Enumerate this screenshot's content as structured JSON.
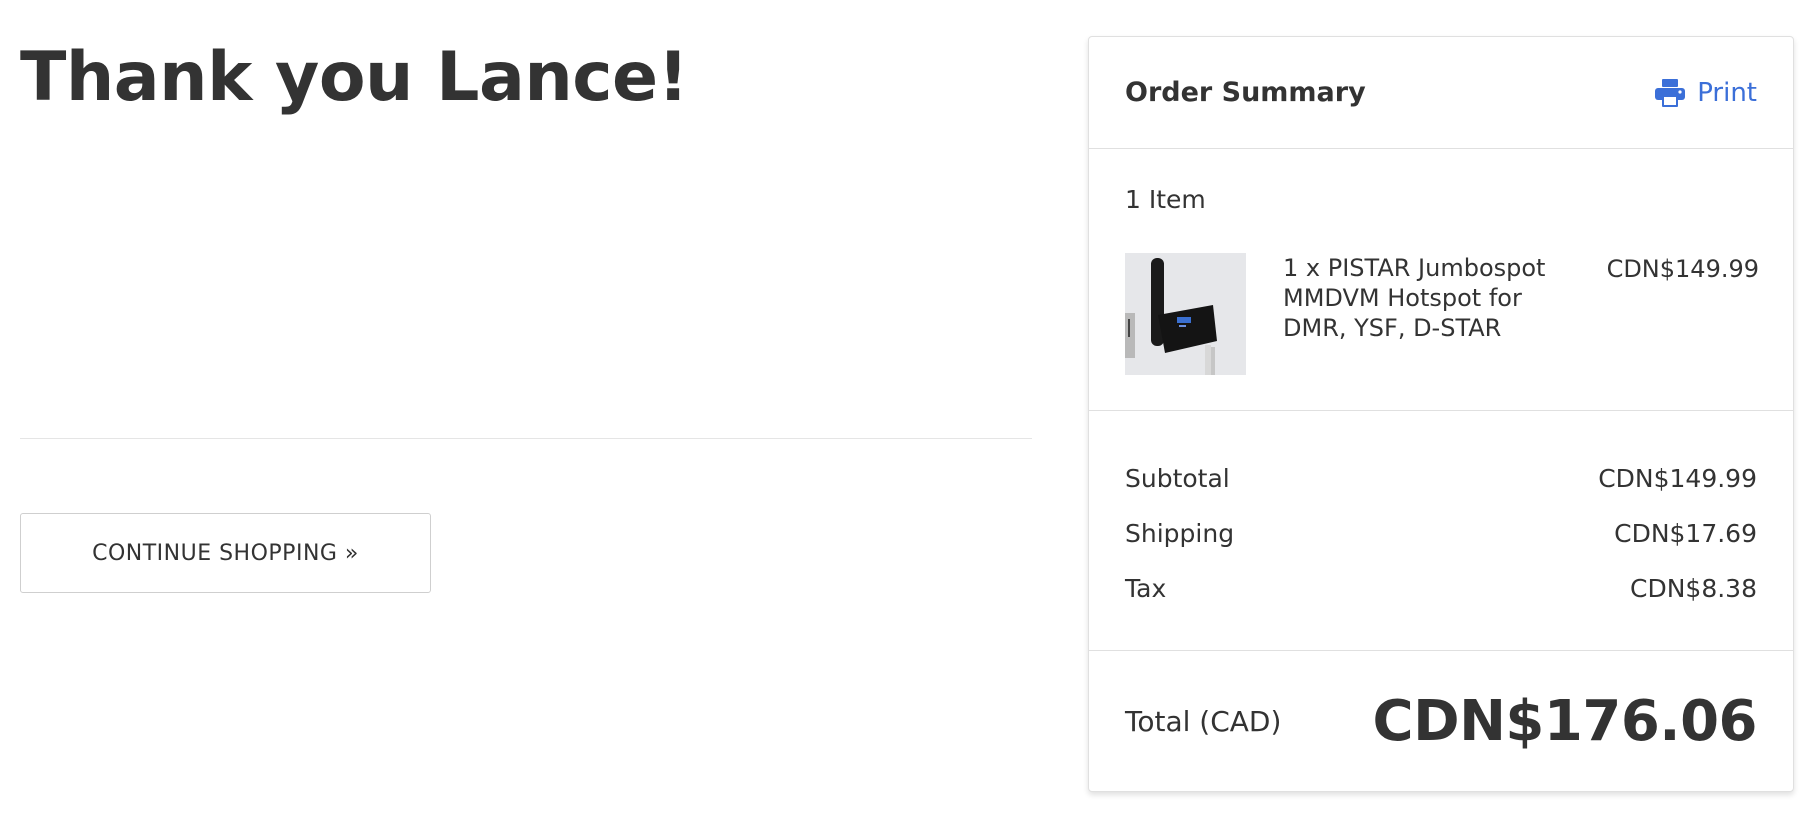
{
  "heading": "Thank you Lance!",
  "continue_button": "CONTINUE SHOPPING »",
  "summary": {
    "title": "Order Summary",
    "print_label": "Print",
    "print_icon": "printer-icon",
    "accent_color": "#3b6fd8",
    "item_count": "1 Item",
    "items": [
      {
        "name": "1 x PISTAR Jumbospot MMDVM Hotspot for DMR, YSF, D-STAR",
        "price": "CDN$149.99"
      }
    ],
    "subtotal_label": "Subtotal",
    "subtotal_value": "CDN$149.99",
    "shipping_label": "Shipping",
    "shipping_value": "CDN$17.69",
    "tax_label": "Tax",
    "tax_value": "CDN$8.38",
    "total_label": "Total (CAD)",
    "total_value": "CDN$176.06"
  }
}
